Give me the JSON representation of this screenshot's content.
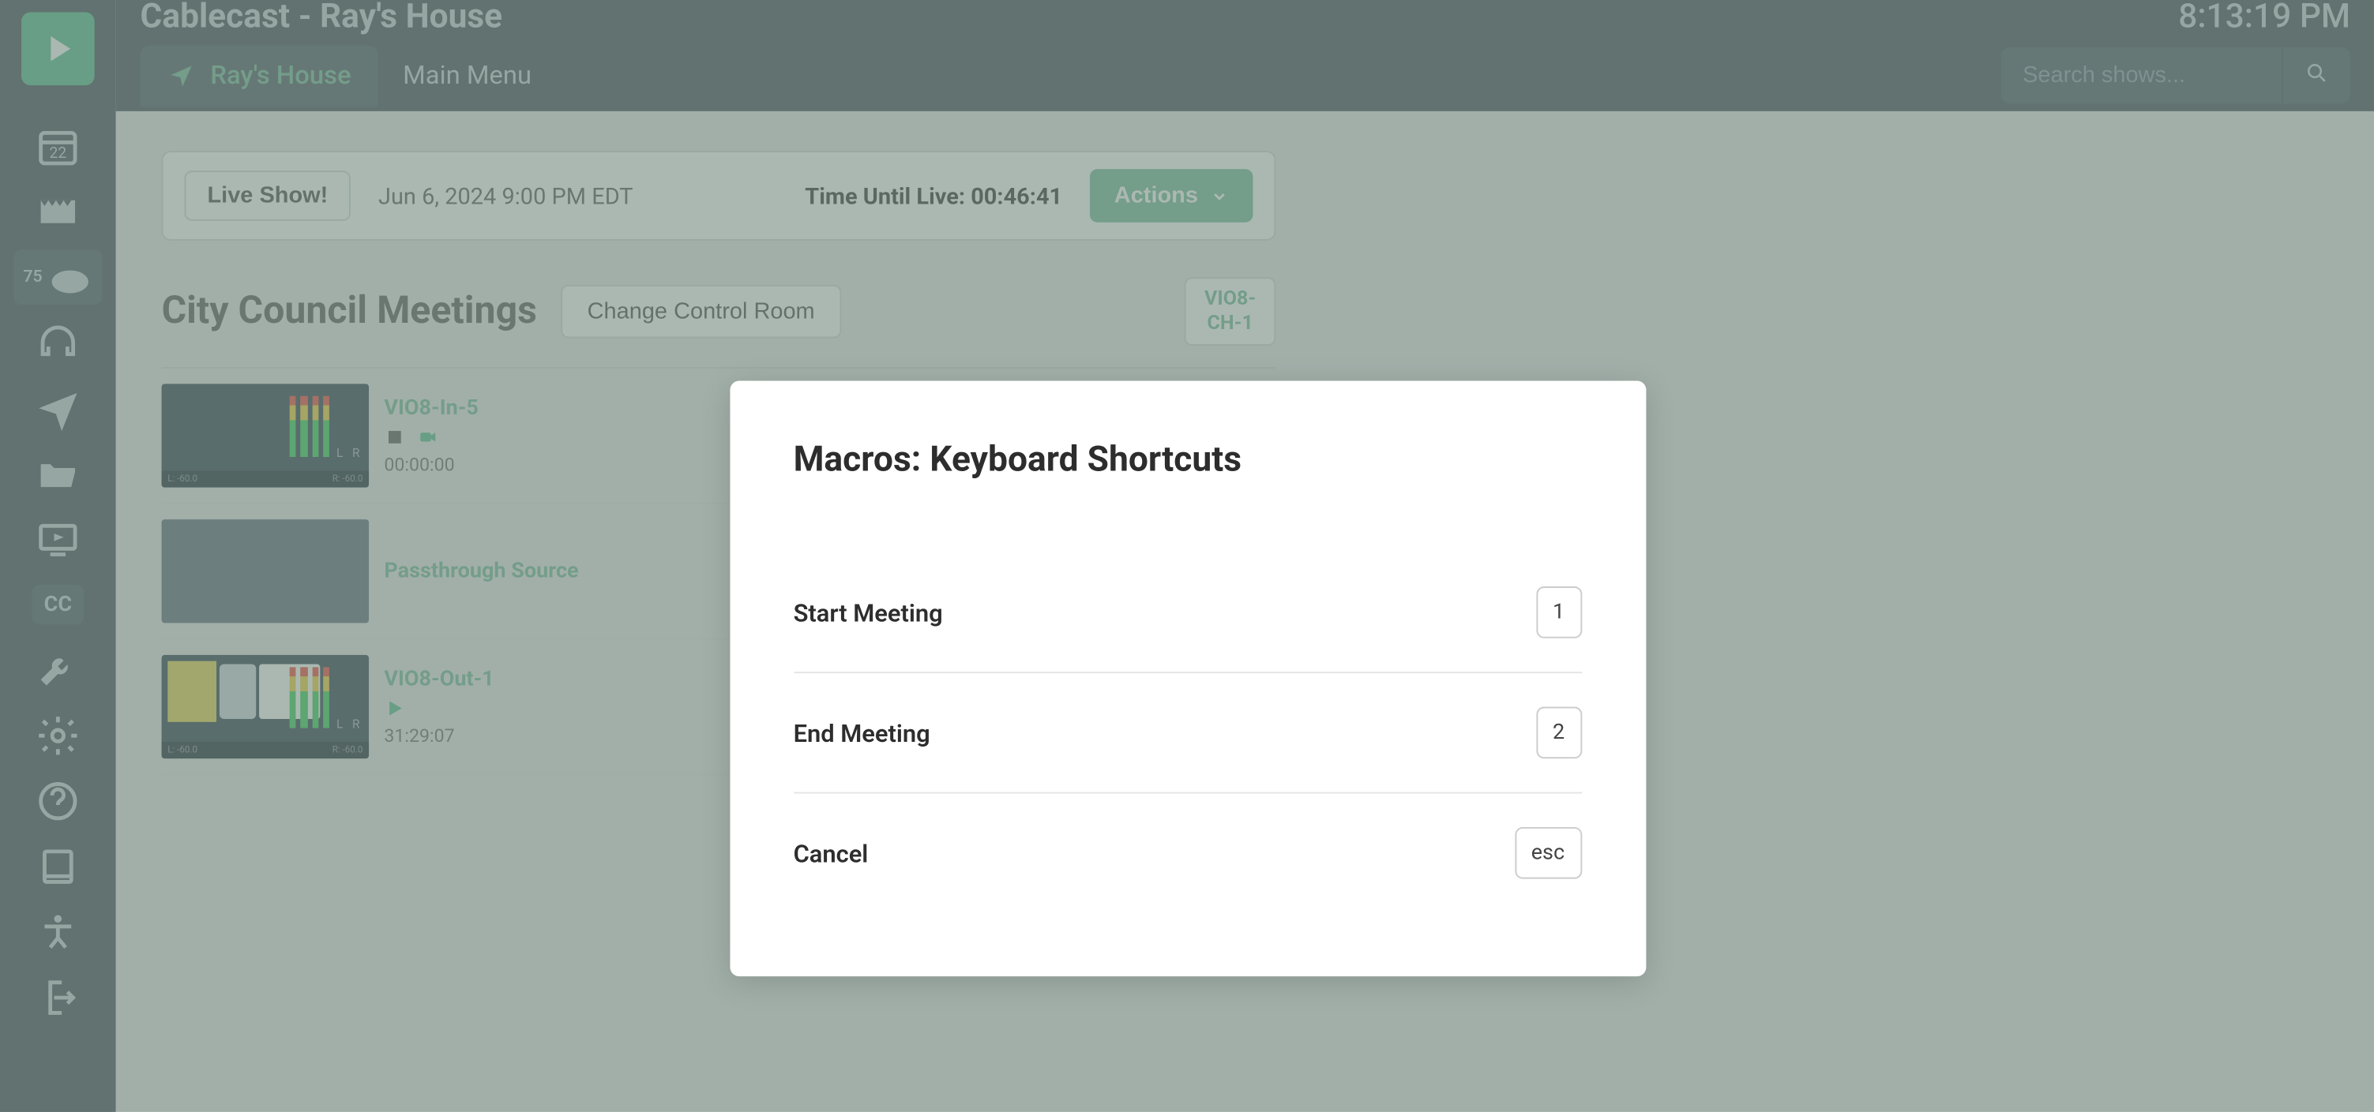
{
  "header": {
    "app_title": "Cablecast - Ray's House",
    "clock": "8:13:19 PM",
    "location": "Ray's House",
    "main_menu": "Main Menu",
    "search_placeholder": "Search shows..."
  },
  "sidebar": {
    "calendar_day": "22",
    "tv_badge": "75",
    "cc_label": "CC"
  },
  "live_bar": {
    "live_show_label": "Live Show!",
    "date": "Jun 6, 2024 9:00 PM EDT",
    "countdown": "Time Until Live: 00:46:41",
    "actions_label": "Actions"
  },
  "room": {
    "title": "City Council Meetings",
    "change_label": "Change Control Room",
    "channel_line1": "VIO8-",
    "channel_line2": "CH-1"
  },
  "sources": [
    {
      "name": "VIO8-In-5",
      "time": "00:00:00",
      "thumb_footer_left": "L: -60.0",
      "thumb_footer_right": "R: -60.0",
      "thumb_lr_l": "L",
      "thumb_lr_r": "R",
      "has_bars": true,
      "stop_icon_color": "#555",
      "cam_icon_color": "#4fba8a"
    },
    {
      "name": "Passthrough Source",
      "time": "",
      "grey": true
    },
    {
      "name": "VIO8-Out-1",
      "time": "31:29:07",
      "thumb_footer_left": "L: -60.0",
      "thumb_footer_right": "R: -60.0",
      "thumb_lr_l": "L",
      "thumb_lr_r": "R",
      "has_bars": true,
      "has_yellow": true,
      "play_icon_color": "#4fba8a"
    }
  ],
  "modal": {
    "title": "Macros: Keyboard Shortcuts",
    "rows": [
      {
        "label": "Start Meeting",
        "key": "1"
      },
      {
        "label": "End Meeting",
        "key": "2"
      },
      {
        "label": "Cancel",
        "key": "esc"
      }
    ]
  }
}
